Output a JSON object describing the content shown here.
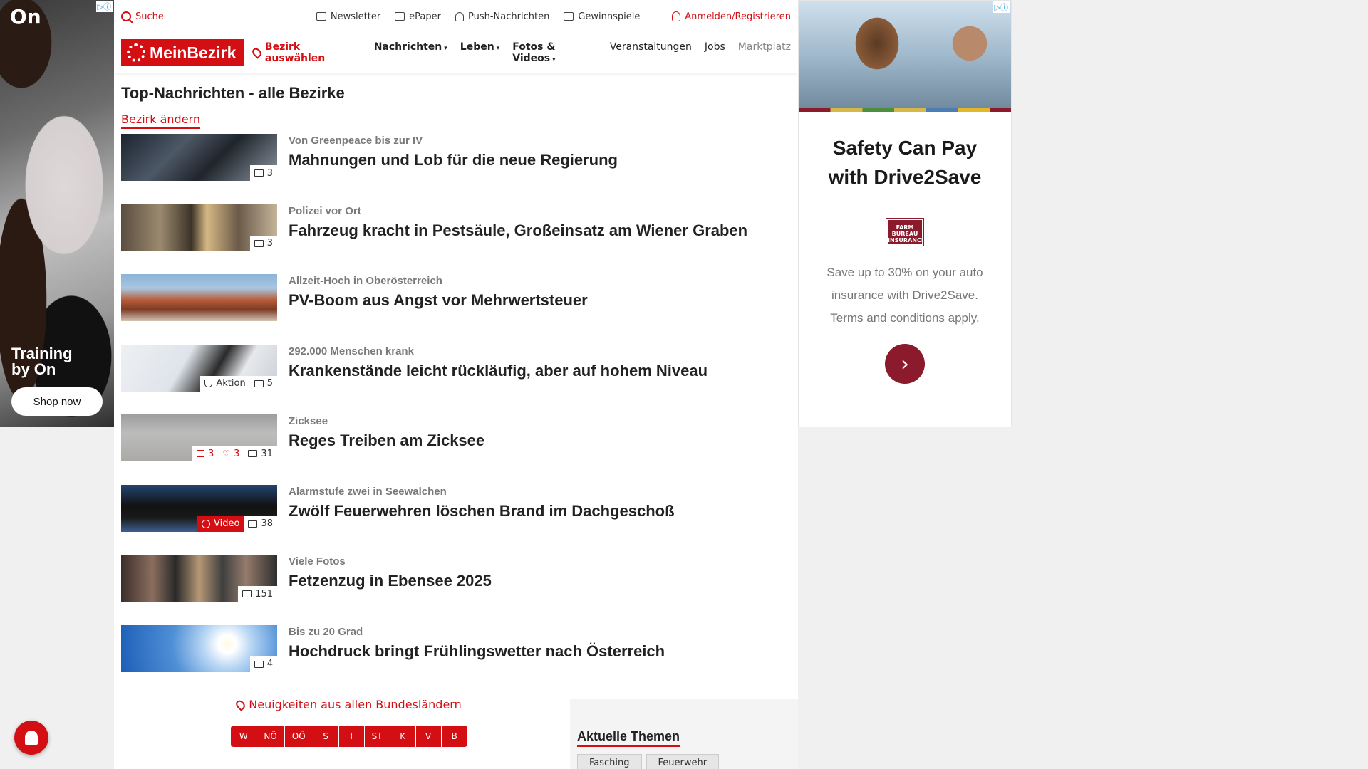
{
  "left_ad": {
    "logo": "On",
    "tagline": "Training by On",
    "cta": "Shop now"
  },
  "topbar": {
    "search": "Suche",
    "links": [
      "Newsletter",
      "ePaper",
      "Push-Nachrichten",
      "Gewinnspiele"
    ],
    "login": "Anmelden/Registrieren"
  },
  "navbar": {
    "brand": "MeinBezirk",
    "bezirk": "Bezirk auswählen",
    "links": [
      "Nachrichten",
      "Leben",
      "Fotos & Videos",
      "Veranstaltungen",
      "Jobs",
      "Marktplatz"
    ]
  },
  "page": {
    "title": "Top-Nachrichten - alle Bezirke",
    "change_bezirk": "Bezirk ändern"
  },
  "articles": [
    {
      "kicker": "Von Greenpeace bis zur IV",
      "headline": "Mahnungen und Lob für die neue Regierung",
      "images": "3"
    },
    {
      "kicker": "Polizei vor Ort",
      "headline": "Fahrzeug kracht in Pestsäule, Großeinsatz am Wiener Graben",
      "images": "3"
    },
    {
      "kicker": "Allzeit-Hoch in Oberösterreich",
      "headline": "PV-Boom aus Angst vor Mehrwertsteuer",
      "images": ""
    },
    {
      "kicker": "292.000 Menschen krank",
      "headline": "Krankenstände leicht rückläufig, aber auf hohem Niveau",
      "aktion": "Aktion",
      "images": "5"
    },
    {
      "kicker": "Zicksee",
      "headline": "Reges Treiben am Zicksee",
      "comments": "3",
      "likes": "3",
      "images": "31"
    },
    {
      "kicker": "Alarmstufe zwei in Seewalchen",
      "headline": "Zwölf Feuerwehren löschen Brand im Dachgeschoß",
      "video": "Video",
      "images": "38"
    },
    {
      "kicker": "Viele Fotos",
      "headline": "Fetzenzug in Ebensee 2025",
      "images": "151"
    },
    {
      "kicker": "Bis zu 20 Grad",
      "headline": "Hochdruck bringt Frühlingswetter nach Österreich",
      "images": "4"
    }
  ],
  "regions": {
    "title": "Neuigkeiten aus allen Bundesländern",
    "buttons": [
      "W",
      "NÖ",
      "OÖ",
      "S",
      "T",
      "ST",
      "K",
      "V",
      "B"
    ]
  },
  "aktuelle_themen": {
    "title": "Aktuelle Themen",
    "tags": [
      "Fasching",
      "Feuerwehr"
    ]
  },
  "right_ad": {
    "headline_line1": "Safety Can Pay",
    "headline_line2": "with Drive2Save",
    "logo_text": "FARM BUREAU INSURANCE",
    "copy_line1": "Save up to 30% on your auto",
    "copy_line2": "insurance with Drive2Save.",
    "copy_line3": "Terms and conditions apply."
  }
}
